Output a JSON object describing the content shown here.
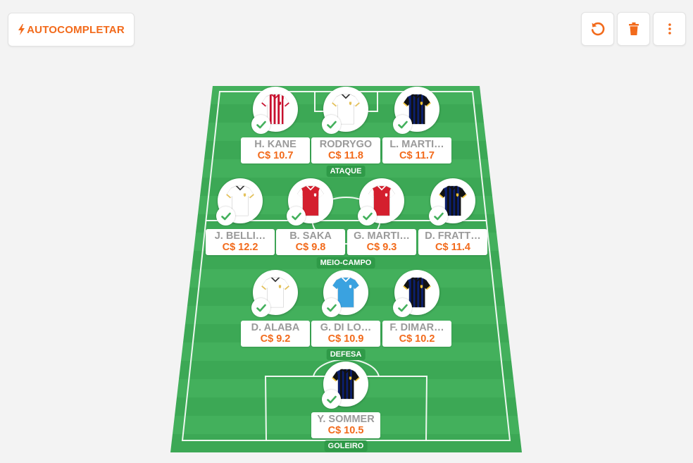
{
  "toolbar": {
    "autocomplete_label": "AUTOCOMPLETAR",
    "undo_icon": "undo-icon",
    "delete_icon": "trash-icon",
    "more_icon": "more-vertical-icon"
  },
  "colors": {
    "accent": "#f26a1b",
    "field": "#43b05c",
    "check": "#43b05c",
    "name_text": "#9a9a9a"
  },
  "sections": {
    "ataque": "ATAQUE",
    "meio": "MEIO-CAMPO",
    "defesa": "DEFESA",
    "goleiro": "GOLEIRO"
  },
  "players": {
    "ataque": [
      {
        "name": "H. KANE",
        "price": "C$ 10.7",
        "kit": "red-white"
      },
      {
        "name": "RODRYGO",
        "price": "C$ 11.8",
        "kit": "white"
      },
      {
        "name": "L. MARTI…",
        "price": "C$ 11.7",
        "kit": "black-blue"
      }
    ],
    "meio": [
      {
        "name": "J. BELLI…",
        "price": "C$ 12.2",
        "kit": "white"
      },
      {
        "name": "B. SAKA",
        "price": "C$ 9.8",
        "kit": "red"
      },
      {
        "name": "G. MARTI…",
        "price": "C$ 9.3",
        "kit": "red"
      },
      {
        "name": "D. FRATT…",
        "price": "C$ 11.4",
        "kit": "black-blue"
      }
    ],
    "defesa": [
      {
        "name": "D. ALABA",
        "price": "C$ 9.2",
        "kit": "white"
      },
      {
        "name": "G. DI LO…",
        "price": "C$ 10.9",
        "kit": "sky-blue"
      },
      {
        "name": "F. DIMAR…",
        "price": "C$ 10.2",
        "kit": "black-blue"
      }
    ],
    "goleiro": [
      {
        "name": "Y. SOMMER",
        "price": "C$ 10.5",
        "kit": "black-blue"
      }
    ]
  }
}
